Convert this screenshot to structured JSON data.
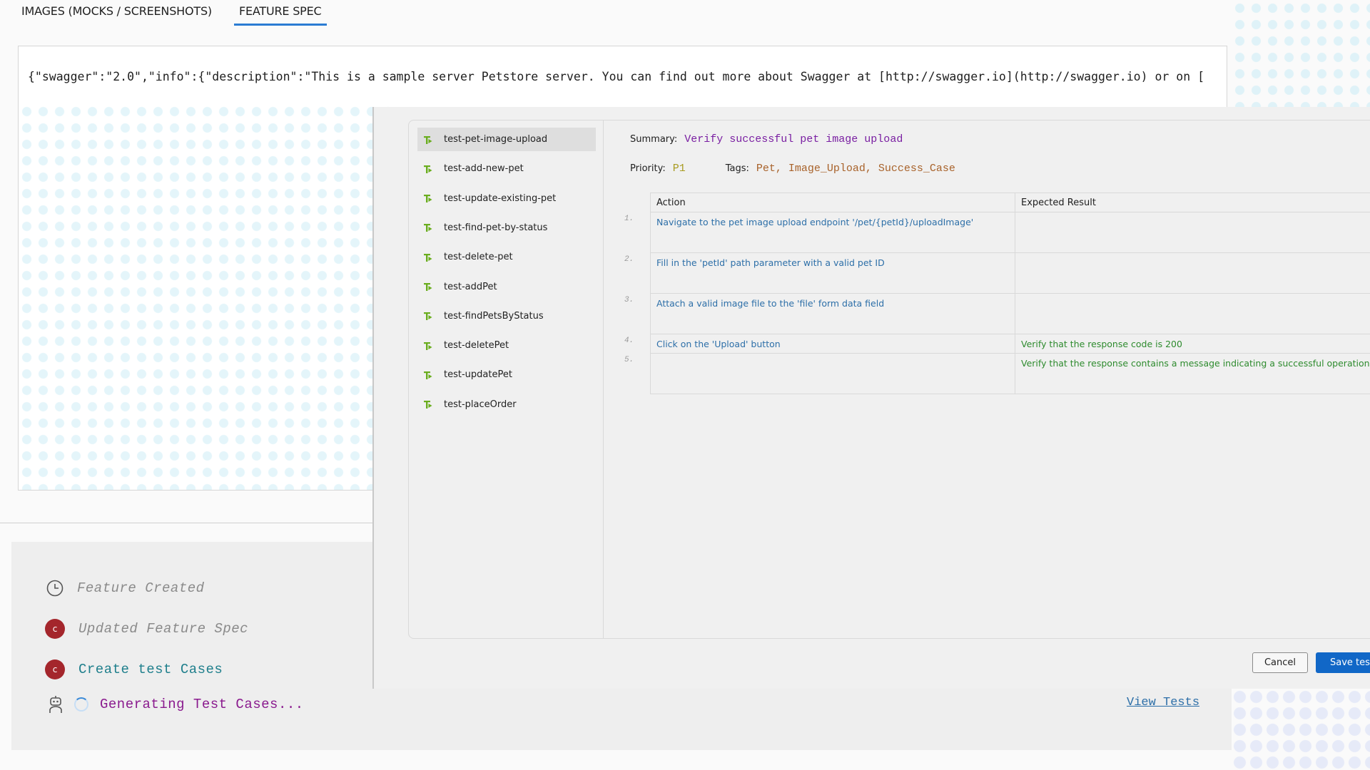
{
  "tabs": [
    {
      "label": "IMAGES (MOCKS / SCREENSHOTS)",
      "active": false
    },
    {
      "label": "FEATURE SPEC",
      "active": true
    }
  ],
  "spec": {
    "text": "{\"swagger\":\"2.0\",\"info\":{\"description\":\"This is a sample server Petstore server.  You can find out more about Swagger at [http://swagger.io](http://swagger.io) or on ["
  },
  "timeline": [
    {
      "icon": "clock-icon",
      "label": "Feature Created",
      "style": "muted"
    },
    {
      "icon": "avatar-c",
      "avatar_letter": "c",
      "label": "Updated Feature Spec",
      "style": "muted"
    },
    {
      "icon": "avatar-c",
      "avatar_letter": "c",
      "label": "Create test Cases",
      "style": "teal"
    },
    {
      "icon": "robot-icon",
      "label": "Generating Test Cases...",
      "style": "purple",
      "loading": true
    }
  ],
  "view_tests_label": "View Tests",
  "modal": {
    "tests": [
      {
        "name": "test-pet-image-upload",
        "selected": true
      },
      {
        "name": "test-add-new-pet"
      },
      {
        "name": "test-update-existing-pet"
      },
      {
        "name": "test-find-pet-by-status"
      },
      {
        "name": "test-delete-pet"
      },
      {
        "name": "test-addPet"
      },
      {
        "name": "test-findPetsByStatus"
      },
      {
        "name": "test-deletePet"
      },
      {
        "name": "test-updatePet"
      },
      {
        "name": "test-placeOrder"
      }
    ],
    "detail": {
      "summary_label": "Summary:",
      "summary": "Verify successful pet image upload",
      "priority_label": "Priority:",
      "priority": "P1",
      "tags_label": "Tags:",
      "tags": "Pet, Image_Upload, Success_Case",
      "columns": [
        "Action",
        "Expected Result"
      ],
      "steps": [
        {
          "num": "1.",
          "action": "Navigate to the pet image upload endpoint '/pet/{petId}/uploadImage'",
          "expected": ""
        },
        {
          "num": "2.",
          "action": "Fill in the 'petId' path parameter with a valid pet ID",
          "expected": ""
        },
        {
          "num": "3.",
          "action": "Attach a valid image file to the 'file' form data field",
          "expected": ""
        },
        {
          "num": "4.",
          "action": "Click on the 'Upload' button",
          "expected": "Verify that the response code is 200"
        },
        {
          "num": "5.",
          "action": "",
          "expected": "Verify that the response contains a message indicating a successful operation"
        }
      ]
    },
    "cancel_label": "Cancel",
    "save_label": "Save tests"
  },
  "colors": {
    "accent": "#2b7cd3",
    "save_button": "#1167c7",
    "avatar": "#a4262c",
    "test_icon": "#6aad1e"
  }
}
